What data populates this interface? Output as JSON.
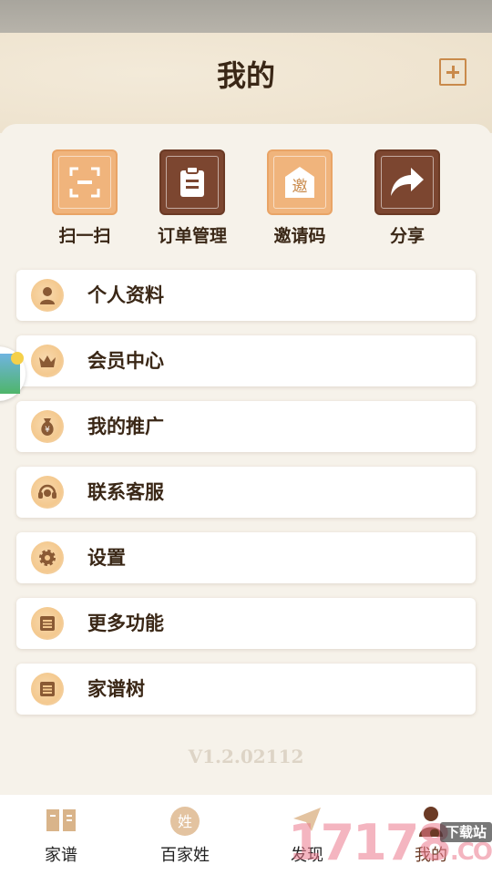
{
  "header": {
    "title": "我的"
  },
  "quick_actions": [
    {
      "label": "扫一扫",
      "icon": "scan-icon"
    },
    {
      "label": "订单管理",
      "icon": "clipboard-icon"
    },
    {
      "label": "邀请码",
      "icon": "invite-envelope-icon",
      "glyph": "邀"
    },
    {
      "label": "分享",
      "icon": "share-arrow-icon"
    }
  ],
  "menu": [
    {
      "label": "个人资料",
      "icon": "person-icon"
    },
    {
      "label": "会员中心",
      "icon": "crown-icon"
    },
    {
      "label": "我的推广",
      "icon": "money-bag-icon",
      "glyph": "¥"
    },
    {
      "label": "联系客服",
      "icon": "headset-icon"
    },
    {
      "label": "设置",
      "icon": "gear-icon"
    },
    {
      "label": "更多功能",
      "icon": "list-icon"
    },
    {
      "label": "家谱树",
      "icon": "list-icon"
    }
  ],
  "version": "V1.2.02112",
  "tabbar": [
    {
      "label": "家谱",
      "icon": "book-icon"
    },
    {
      "label": "百家姓",
      "icon": "surname-icon",
      "glyph": "姓"
    },
    {
      "label": "发现",
      "icon": "paper-plane-icon"
    },
    {
      "label": "我的",
      "icon": "user-icon",
      "active": true
    }
  ],
  "watermark": {
    "text": "17178",
    "badge": "下载站",
    "suffix": ".COM"
  },
  "colors": {
    "accent_light": "#f0b47c",
    "accent_dark": "#7c4630",
    "text_dark": "#3a2716",
    "background": "#f6f2ea"
  }
}
